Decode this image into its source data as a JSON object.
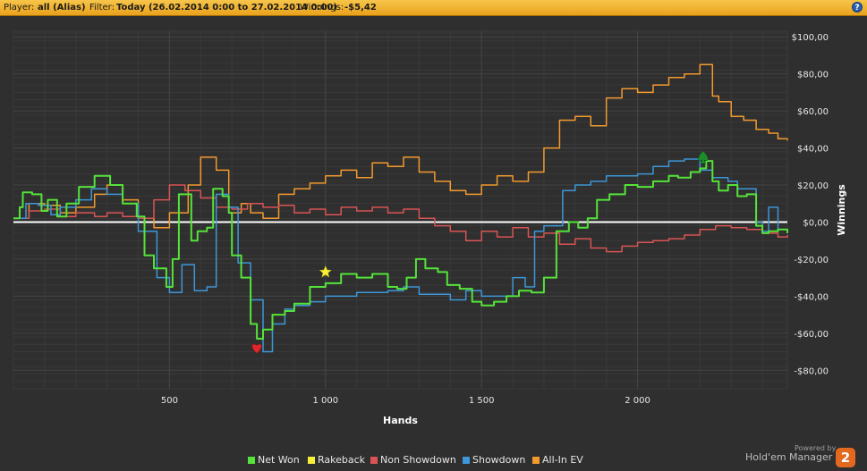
{
  "header": {
    "player_label": "Player:",
    "player_value": "all (Alias)",
    "filter_label": "Filter:",
    "filter_value": "Today (26.02.2014 0:00 to 27.02.2014 0:00)",
    "winnings_label": "Winnings:",
    "winnings_value": "-$5,42",
    "help_glyph": "?"
  },
  "branding": {
    "powered_by": "Powered by",
    "product": "Hold'em Manager",
    "logo_glyph": "2"
  },
  "chart_data": {
    "type": "line",
    "xlabel": "Hands",
    "ylabel": "Winnings",
    "xlim": [
      0,
      2480
    ],
    "ylim": [
      -90,
      103
    ],
    "x_ticks": [
      500,
      1000,
      1500,
      2000
    ],
    "x_tick_labels": [
      "500",
      "1 000",
      "1 500",
      "2 000"
    ],
    "y_ticks": [
      100,
      80,
      60,
      40,
      20,
      0,
      -20,
      -40,
      -60,
      -80
    ],
    "y_tick_labels": [
      "$100,00",
      "$80,00",
      "$60,00",
      "$40,00",
      "$20,00",
      "$0,00",
      "-$20,00",
      "-$40,00",
      "-$60,00",
      "-$80,00"
    ],
    "grid": true,
    "legend_position": "bottom",
    "background": "#2f2f2f",
    "grid_color": "#454545",
    "zero_line_color": "#ffffff",
    "series": [
      {
        "name": "Net Won",
        "color": "#55e33a",
        "points": [
          [
            0,
            2
          ],
          [
            20,
            8
          ],
          [
            30,
            16
          ],
          [
            60,
            15
          ],
          [
            90,
            6
          ],
          [
            110,
            12
          ],
          [
            140,
            3
          ],
          [
            170,
            10
          ],
          [
            210,
            19
          ],
          [
            260,
            25
          ],
          [
            310,
            20
          ],
          [
            350,
            10
          ],
          [
            395,
            3
          ],
          [
            420,
            -18
          ],
          [
            450,
            -25
          ],
          [
            490,
            -35
          ],
          [
            510,
            -20
          ],
          [
            530,
            15
          ],
          [
            570,
            -10
          ],
          [
            590,
            -5
          ],
          [
            620,
            -3
          ],
          [
            640,
            18
          ],
          [
            670,
            14
          ],
          [
            690,
            5
          ],
          [
            700,
            -18
          ],
          [
            730,
            -30
          ],
          [
            760,
            -55
          ],
          [
            780,
            -63
          ],
          [
            800,
            -58
          ],
          [
            830,
            -50
          ],
          [
            870,
            -48
          ],
          [
            900,
            -44
          ],
          [
            950,
            -35
          ],
          [
            1000,
            -33
          ],
          [
            1050,
            -28
          ],
          [
            1100,
            -30
          ],
          [
            1150,
            -28
          ],
          [
            1200,
            -35
          ],
          [
            1230,
            -36
          ],
          [
            1260,
            -30
          ],
          [
            1290,
            -20
          ],
          [
            1320,
            -25
          ],
          [
            1360,
            -27
          ],
          [
            1390,
            -34
          ],
          [
            1430,
            -36
          ],
          [
            1470,
            -43
          ],
          [
            1500,
            -45
          ],
          [
            1540,
            -43
          ],
          [
            1580,
            -40
          ],
          [
            1620,
            -37
          ],
          [
            1660,
            -38
          ],
          [
            1700,
            -30
          ],
          [
            1740,
            -5
          ],
          [
            1780,
            0
          ],
          [
            1810,
            -3
          ],
          [
            1840,
            2
          ],
          [
            1870,
            12
          ],
          [
            1910,
            15
          ],
          [
            1960,
            20
          ],
          [
            2000,
            19
          ],
          [
            2050,
            22
          ],
          [
            2100,
            25
          ],
          [
            2130,
            24
          ],
          [
            2170,
            27
          ],
          [
            2200,
            29
          ],
          [
            2220,
            33
          ],
          [
            2240,
            22
          ],
          [
            2260,
            17
          ],
          [
            2290,
            20
          ],
          [
            2320,
            14
          ],
          [
            2350,
            15
          ],
          [
            2380,
            -2
          ],
          [
            2400,
            -6
          ],
          [
            2420,
            -5
          ],
          [
            2450,
            -4
          ],
          [
            2480,
            -6
          ]
        ]
      },
      {
        "name": "Rakeback",
        "color": "#f6f03a",
        "points": []
      },
      {
        "name": "Non Showdown",
        "color": "#d95454",
        "points": [
          [
            0,
            2
          ],
          [
            50,
            6
          ],
          [
            100,
            7
          ],
          [
            150,
            3
          ],
          [
            200,
            5
          ],
          [
            260,
            3
          ],
          [
            300,
            5
          ],
          [
            350,
            3
          ],
          [
            400,
            2
          ],
          [
            450,
            12
          ],
          [
            500,
            20
          ],
          [
            550,
            17
          ],
          [
            600,
            13
          ],
          [
            650,
            8
          ],
          [
            700,
            7
          ],
          [
            750,
            10
          ],
          [
            800,
            8
          ],
          [
            850,
            9
          ],
          [
            900,
            5
          ],
          [
            950,
            7
          ],
          [
            1000,
            4
          ],
          [
            1050,
            8
          ],
          [
            1100,
            6
          ],
          [
            1150,
            8
          ],
          [
            1200,
            5
          ],
          [
            1250,
            7
          ],
          [
            1300,
            2
          ],
          [
            1350,
            -2
          ],
          [
            1400,
            -5
          ],
          [
            1450,
            -10
          ],
          [
            1500,
            -5
          ],
          [
            1550,
            -8
          ],
          [
            1600,
            -3
          ],
          [
            1650,
            -8
          ],
          [
            1700,
            -6
          ],
          [
            1750,
            -12
          ],
          [
            1800,
            -9
          ],
          [
            1850,
            -14
          ],
          [
            1900,
            -16
          ],
          [
            1950,
            -13
          ],
          [
            2000,
            -11
          ],
          [
            2050,
            -10
          ],
          [
            2100,
            -9
          ],
          [
            2150,
            -7
          ],
          [
            2200,
            -4
          ],
          [
            2250,
            -2
          ],
          [
            2300,
            -3
          ],
          [
            2350,
            -4
          ],
          [
            2400,
            -6
          ],
          [
            2450,
            -8
          ],
          [
            2480,
            -7
          ]
        ]
      },
      {
        "name": "Showdown",
        "color": "#3d97d8",
        "points": [
          [
            0,
            2
          ],
          [
            40,
            10
          ],
          [
            80,
            9
          ],
          [
            120,
            4
          ],
          [
            150,
            8
          ],
          [
            200,
            12
          ],
          [
            250,
            18
          ],
          [
            300,
            15
          ],
          [
            350,
            10
          ],
          [
            400,
            -5
          ],
          [
            460,
            -30
          ],
          [
            500,
            -38
          ],
          [
            540,
            -23
          ],
          [
            580,
            -37
          ],
          [
            620,
            -35
          ],
          [
            650,
            15
          ],
          [
            690,
            8
          ],
          [
            720,
            -22
          ],
          [
            760,
            -42
          ],
          [
            800,
            -70
          ],
          [
            830,
            -55
          ],
          [
            870,
            -47
          ],
          [
            900,
            -45
          ],
          [
            950,
            -43
          ],
          [
            1000,
            -40
          ],
          [
            1100,
            -38
          ],
          [
            1200,
            -37
          ],
          [
            1250,
            -35
          ],
          [
            1300,
            -39
          ],
          [
            1400,
            -42
          ],
          [
            1450,
            -37
          ],
          [
            1500,
            -40
          ],
          [
            1550,
            -40
          ],
          [
            1600,
            -30
          ],
          [
            1640,
            -35
          ],
          [
            1670,
            -5
          ],
          [
            1700,
            -2
          ],
          [
            1760,
            17
          ],
          [
            1800,
            20
          ],
          [
            1850,
            22
          ],
          [
            1900,
            25
          ],
          [
            2000,
            26
          ],
          [
            2050,
            30
          ],
          [
            2100,
            33
          ],
          [
            2150,
            34
          ],
          [
            2200,
            28
          ],
          [
            2240,
            24
          ],
          [
            2290,
            22
          ],
          [
            2320,
            18
          ],
          [
            2350,
            18
          ],
          [
            2380,
            0
          ],
          [
            2400,
            -5
          ],
          [
            2420,
            8
          ],
          [
            2450,
            -4
          ],
          [
            2480,
            -6
          ]
        ]
      },
      {
        "name": "All-In EV",
        "color": "#f29a2e",
        "points": [
          [
            0,
            2
          ],
          [
            50,
            10
          ],
          [
            100,
            9
          ],
          [
            150,
            5
          ],
          [
            200,
            8
          ],
          [
            260,
            15
          ],
          [
            300,
            20
          ],
          [
            350,
            12
          ],
          [
            400,
            2
          ],
          [
            450,
            -3
          ],
          [
            500,
            5
          ],
          [
            560,
            20
          ],
          [
            600,
            35
          ],
          [
            650,
            28
          ],
          [
            690,
            5
          ],
          [
            730,
            10
          ],
          [
            760,
            5
          ],
          [
            800,
            2
          ],
          [
            850,
            15
          ],
          [
            900,
            18
          ],
          [
            950,
            21
          ],
          [
            1000,
            25
          ],
          [
            1050,
            28
          ],
          [
            1100,
            24
          ],
          [
            1150,
            32
          ],
          [
            1200,
            30
          ],
          [
            1250,
            35
          ],
          [
            1300,
            27
          ],
          [
            1350,
            22
          ],
          [
            1400,
            17
          ],
          [
            1450,
            15
          ],
          [
            1500,
            20
          ],
          [
            1550,
            25
          ],
          [
            1600,
            22
          ],
          [
            1650,
            27
          ],
          [
            1700,
            40
          ],
          [
            1750,
            55
          ],
          [
            1800,
            57
          ],
          [
            1850,
            52
          ],
          [
            1900,
            67
          ],
          [
            1950,
            72
          ],
          [
            2000,
            70
          ],
          [
            2050,
            74
          ],
          [
            2100,
            78
          ],
          [
            2150,
            80
          ],
          [
            2200,
            85
          ],
          [
            2240,
            68
          ],
          [
            2260,
            65
          ],
          [
            2300,
            57
          ],
          [
            2340,
            55
          ],
          [
            2380,
            50
          ],
          [
            2420,
            48
          ],
          [
            2450,
            45
          ],
          [
            2480,
            44
          ]
        ]
      }
    ],
    "markers": [
      {
        "kind": "star",
        "series": "Rakeback",
        "x": 1000,
        "y": -27,
        "color": "#f6f03a"
      },
      {
        "kind": "heart",
        "series": "Net Won",
        "x": 780,
        "y": -68,
        "color": "#e0262b"
      },
      {
        "kind": "spade",
        "series": "Net Won",
        "x": 2210,
        "y": 35,
        "color": "#1e8c2d"
      }
    ]
  }
}
